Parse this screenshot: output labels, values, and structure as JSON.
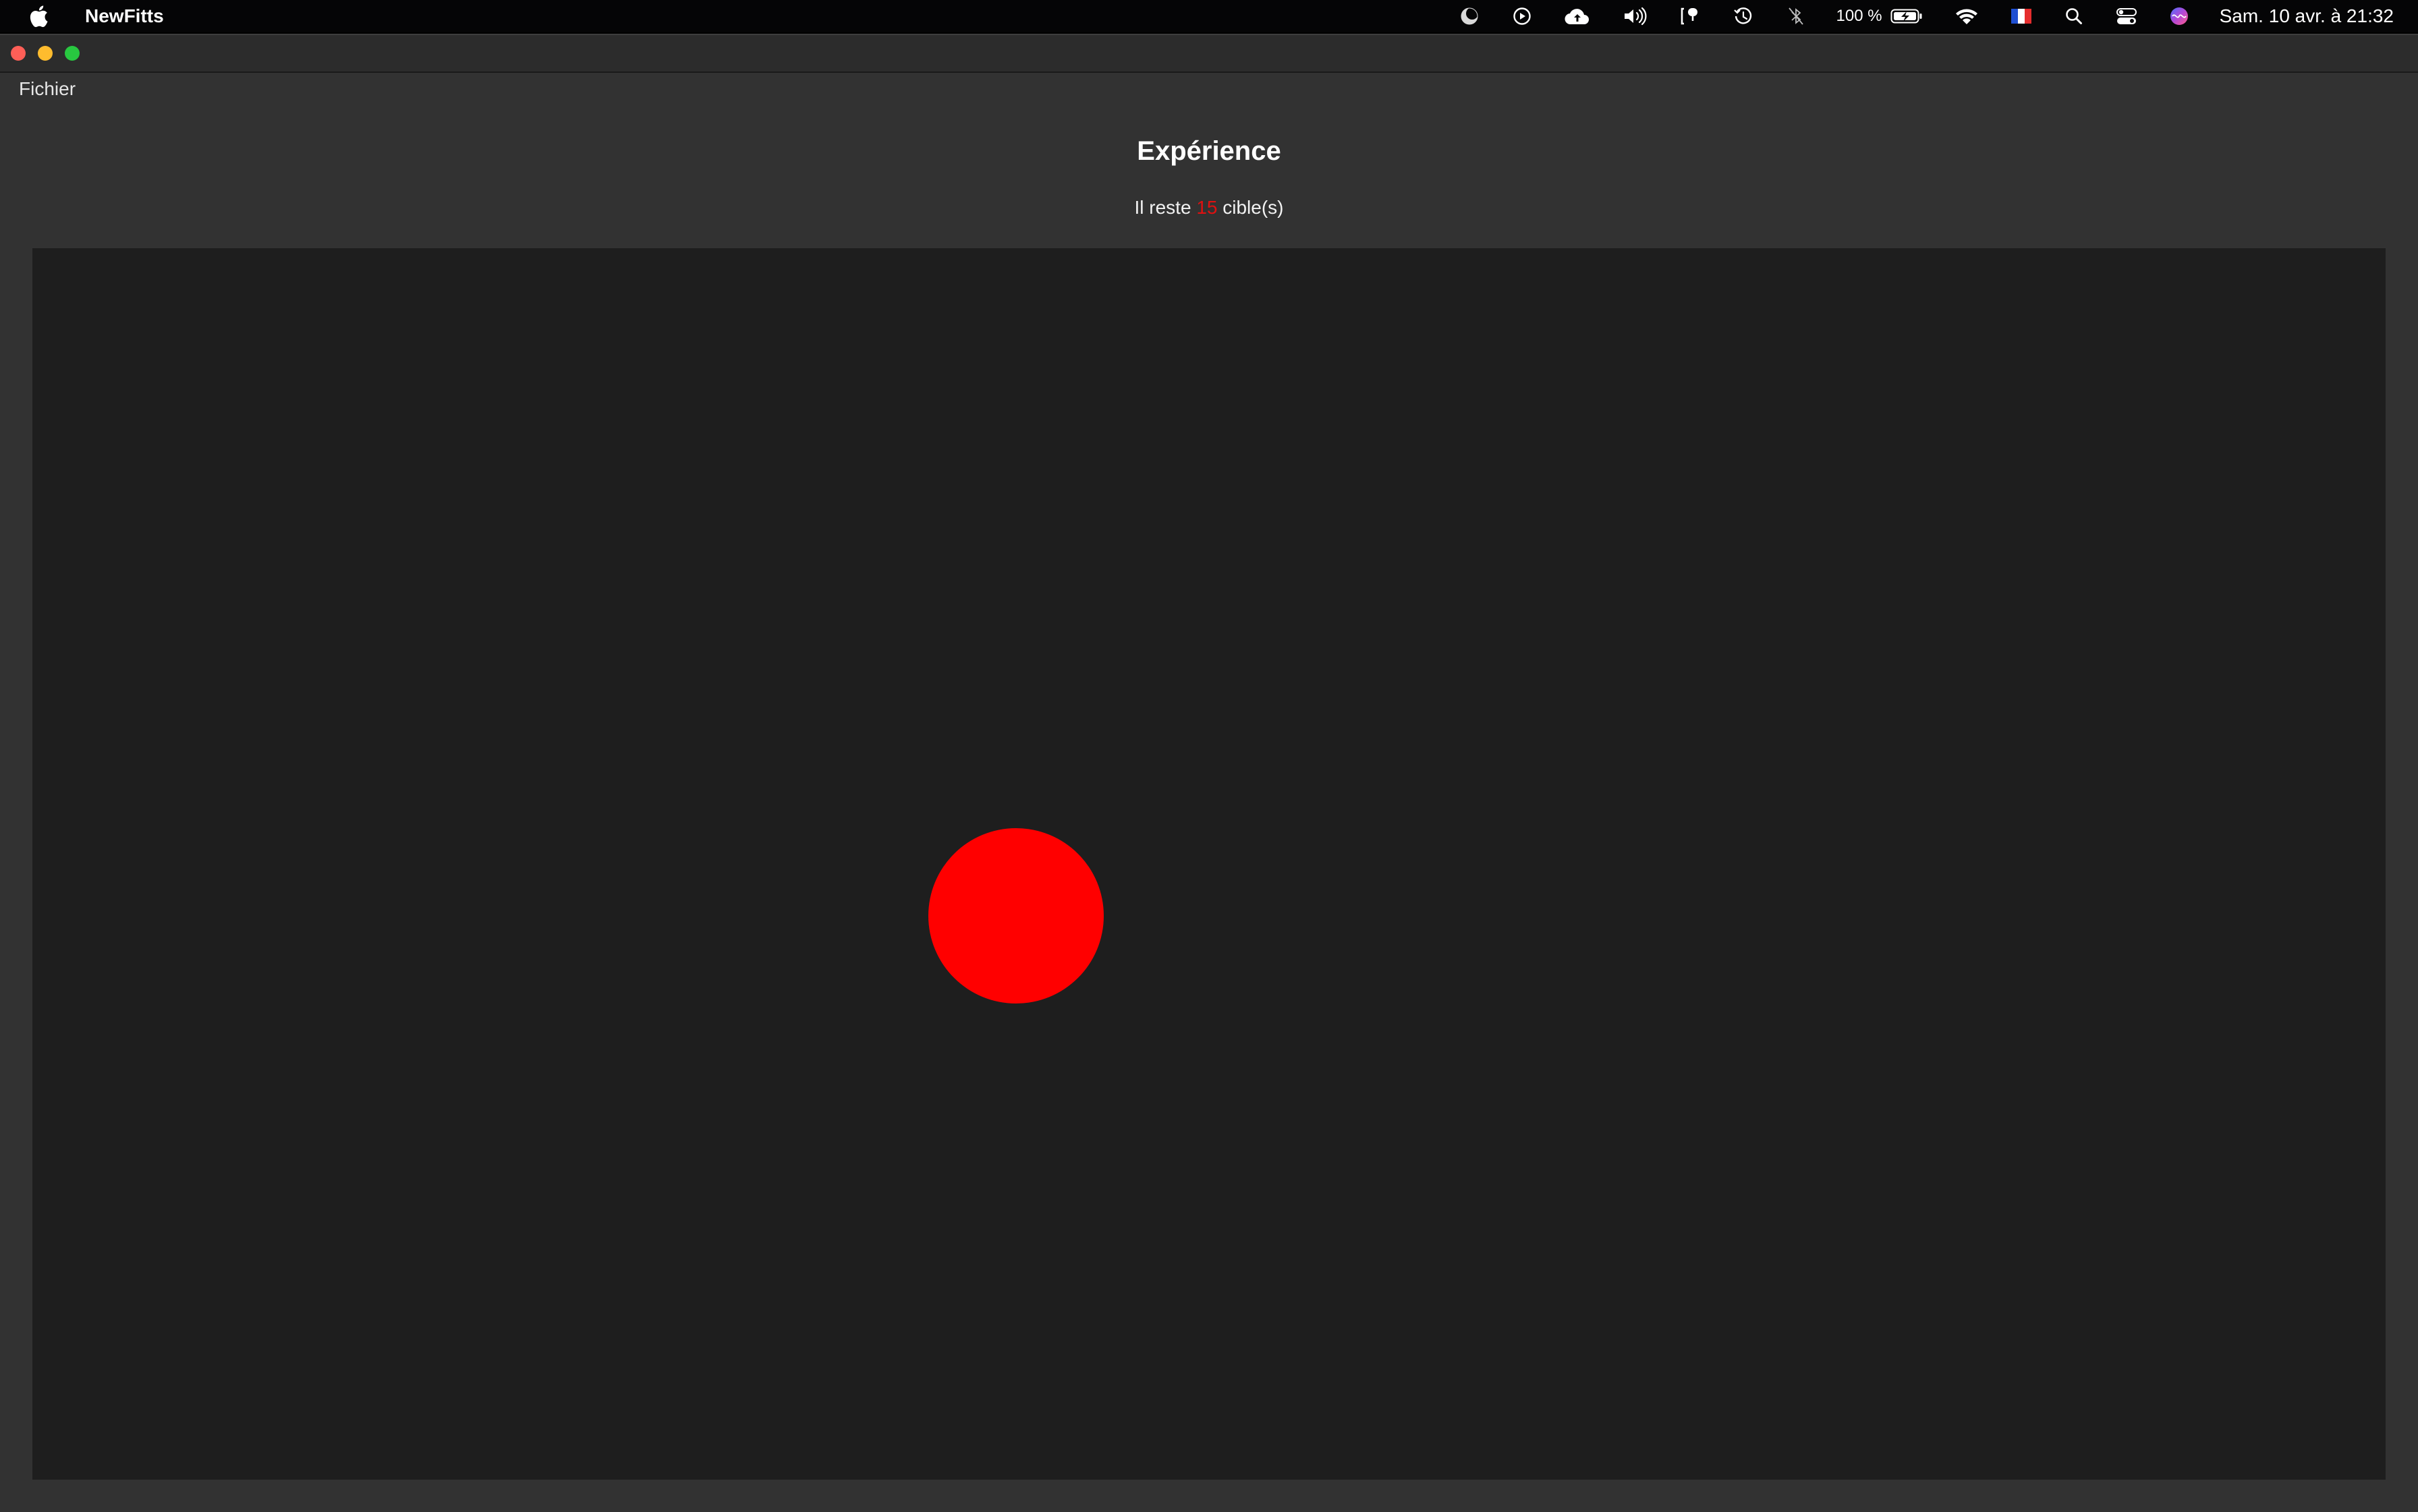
{
  "menubar": {
    "apple_icon": "apple-icon",
    "app_name": "NewFitts",
    "status_icons": [
      "moon-icon",
      "play-circle-icon",
      "cloud-upload-icon",
      "volume-icon",
      "screen-mirroring-icon",
      "time-machine-icon",
      "bluetooth-off-icon"
    ],
    "battery_text": "100 %",
    "battery_icon": "battery-charging-icon",
    "wifi_icon": "wifi-icon",
    "flag_icon": "french-flag-icon",
    "search_icon": "search-icon",
    "control_center_icon": "control-center-icon",
    "siri_icon": "siri-icon",
    "clock": "Sam. 10 avr. à  21:32"
  },
  "window": {
    "menu": {
      "file_label": "Fichier"
    },
    "title": "Expérience",
    "remaining": {
      "prefix": "Il reste ",
      "count": "15",
      "suffix": " cible(s)"
    },
    "colors": {
      "target": "#ff0000",
      "count": "#e01010",
      "canvas": "#1e1e1e",
      "window": "#323232"
    }
  }
}
